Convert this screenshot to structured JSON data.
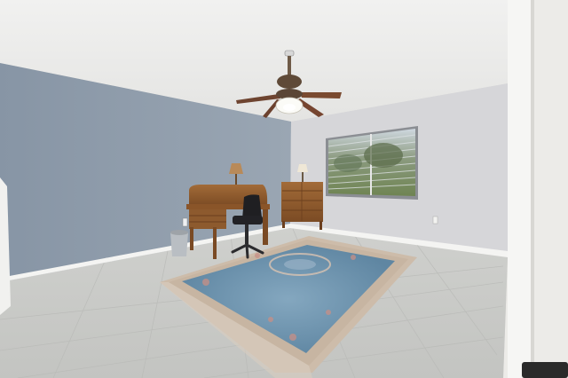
{
  "scene": {
    "subject": "empty-room-interior",
    "colors": {
      "ceiling": "#eeeeed",
      "left_wall": "#8f9cab",
      "back_wall": "#d6d6d9",
      "right_wall": "#ecebe8",
      "floor": "#d1d2cf",
      "rug_field": "#6c92ad",
      "rug_border": "#c9b9a6",
      "desk_wood": "#8e5a2e",
      "baseboard": "#f4f4f2"
    },
    "objects": [
      "ceiling-fan",
      "window",
      "roll-top-desk",
      "office-chair",
      "dresser",
      "table-lamp",
      "area-rug",
      "wastebasket",
      "door-frame"
    ]
  }
}
